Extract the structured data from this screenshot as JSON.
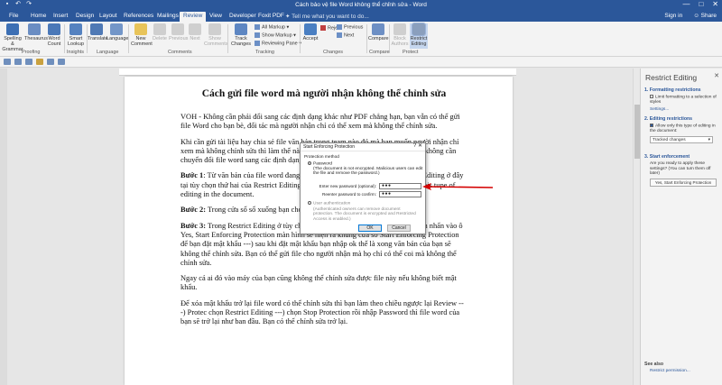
{
  "window": {
    "title": "Cách bảo vệ file Word không thể chỉnh sửa - Word",
    "minimize": "—",
    "maximize": "□",
    "close": "✕"
  },
  "tabs": {
    "items": [
      "File",
      "Home",
      "Insert",
      "Design",
      "Layout",
      "References",
      "Mailings",
      "Review",
      "View",
      "Developer",
      "Foxit PDF"
    ],
    "active": "Review",
    "tell_me": "Tell me what you want to do...",
    "sign_in": "Sign in",
    "share": "Share"
  },
  "ribbon": {
    "spelling": "Spelling & Grammar",
    "thesaurus": "Thesaurus",
    "word_count": "Word Count",
    "smart_lookup": "Smart Lookup",
    "translate": "Translate",
    "language": "Language",
    "new_comment": "New Comment",
    "delete": "Delete",
    "previous": "Previous",
    "next": "Next",
    "show_comments": "Show Comments",
    "track_changes": "Track Changes",
    "all_markup": "All Markup",
    "show_markup": "Show Markup",
    "reviewing_pane": "Reviewing Pane",
    "accept": "Accept",
    "reject": "Reject",
    "prev_change": "Previous",
    "next_change": "Next",
    "compare": "Compare",
    "block_authors": "Block Authors",
    "restrict_editing": "Restrict Editing",
    "groups": {
      "proofing": "Proofing",
      "insights": "Insights",
      "language": "Language",
      "comments": "Comments",
      "tracking": "Tracking",
      "changes": "Changes",
      "compare": "Compare",
      "protect": "Protect"
    }
  },
  "document": {
    "title": "Cách gửi file word mà người nhận không thể chỉnh sửa",
    "p1": "VOH - Không cần phải đổi sang các định dạng khác như PDF chẳng hạn, bạn vẫn có thể gửi file Word cho bạn bè, đối tác mà người nhận chỉ có thể xem mà không thể chỉnh sửa.",
    "p2": "Khi cần gửi tài liệu hay chia sẻ file văn bản trong team nào đó mà bạn muốn người nhận chỉ xem mà không chỉnh sửa thì làm thế nào? Có một cách rất hay và nhanh mà bạn không cần chuyển đổi file word sang các định dạng khác. Cách làm như sau:",
    "s1_label": "Bước 1",
    "s1_text": ": Từ văn bản của file word đang mở, chọn Review rồi chọn tiếp Restrict Editing ở đây tại tùy chọn thứ hai của Restrict Editing bạn đánh dấu tích ☑ vào ô Allow only this tupe of editing in the document.",
    "s2_label": "Bước 2:",
    "s2_text": " Trong cửa sổ sổ xuống bạn chọn tùy chọn thứ 3 là Filling in forms",
    "s3_label": "Bước 3:",
    "s3_text": " Trong Restrict Editing ở tùy chọn thứ ba bên dưới Start enforcement bạn nhấn vào ô Yes, Start Enforcing Protection màn hình sẽ hiện ra khung cửa sổ Start Enforcing Protection để bạn đặt mật khẩu ---) sau khi đặt mật khẩu bạn nhập ok thế là xong văn bản của bạn sẽ không thể chỉnh sửa. Bạn có thể gửi file cho người nhận mà họ chỉ có thể coi mà không thể chỉnh sửa.",
    "p4": "Ngay cả ai đó vào máy của bạn cũng không thể chỉnh sửa được file này nếu không biết mật khẩu.",
    "p5": "Để xóa mật khẩu trở lại file word có thể chỉnh sửa thì bạn làm theo chiều ngược lại Review ---) Protec chọn Restrict Editing ---) chọn Stop Protection rồi nhập Password thì file word của bạn sẽ trở lại như ban đầu. Bạn có thể chỉnh sửa trở lại."
  },
  "dialog": {
    "title": "Start Enforcing Protection",
    "help": "?",
    "close": "✕",
    "method_label": "Protection method",
    "password_option": "Password",
    "password_note": "(The document is not encrypted. Malicious users can edit the file and remove the password.)",
    "enter_label": "Enter new password (optional):",
    "enter_value": "●●●",
    "reenter_label": "Reenter password to confirm:",
    "reenter_value": "●●●",
    "user_auth_option": "User authentication",
    "user_auth_note": "(Authenticated owners can remove document protection. The document is encrypted and Restricted Access is enabled.)",
    "ok": "OK",
    "cancel": "Cancel"
  },
  "pane": {
    "title": "Restrict Editing",
    "close": "✕",
    "s1_head": "1. Formatting restrictions",
    "s1_check": "Limit formatting to a selection of styles",
    "s1_link": "Settings...",
    "s2_head": "2. Editing restrictions",
    "s2_check": "Allow only this type of editing in the document:",
    "s2_select": "Tracked changes",
    "s3_head": "3. Start enforcement",
    "s3_text": "Are you ready to apply these settings? (You can turn them off later)",
    "s3_button": "Yes, Start Enforcing Protection",
    "see_also": "See also",
    "restrict_permission": "Restrict permission..."
  },
  "colors": {
    "brand": "#2b579a",
    "arrow": "#d40000"
  }
}
